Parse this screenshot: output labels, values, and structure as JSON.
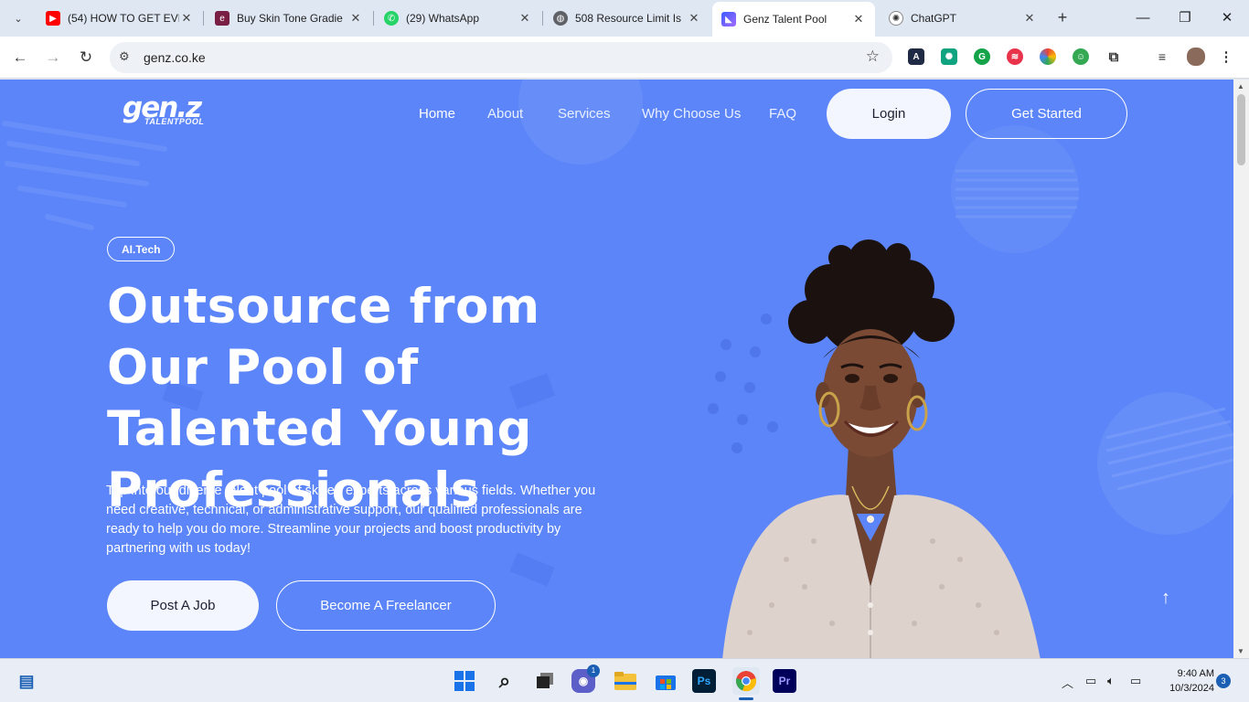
{
  "browser": {
    "tabs": [
      {
        "title": "(54) HOW TO GET EVE",
        "icon": "youtube-icon",
        "color": "#ff0000"
      },
      {
        "title": "Buy Skin Tone Gradie",
        "icon": "envato-icon",
        "color": "#7a1f44"
      },
      {
        "title": "(29) WhatsApp",
        "icon": "whatsapp-icon",
        "color": "#25d366"
      },
      {
        "title": "508 Resource Limit Is",
        "icon": "globe-icon",
        "color": "#5f6368"
      },
      {
        "title": "Genz Talent Pool",
        "icon": "genz-icon",
        "color": "#3d5afe"
      },
      {
        "title": "ChatGPT",
        "icon": "chatgpt-icon",
        "color": "#333333"
      }
    ],
    "active_tab": 4,
    "url": "genz.co.ke"
  },
  "site": {
    "logo_main": "gen.z",
    "logo_sub": "TALENTPOOL",
    "nav": [
      "Home",
      "About",
      "Services",
      "Why Choose Us",
      "FAQ"
    ],
    "login_label": "Login",
    "get_started_label": "Get Started"
  },
  "hero": {
    "tag": "AI.Tech",
    "headline": "Outsource from Our Pool of Talented Young Professionals",
    "description": "Tap into our diverse talent pool of skilled experts across various fields. Whether you need creative, technical, or administrative support, our qualified professionals are ready to help you do more. Streamline your projects and boost productivity by partnering with us today!",
    "primary_button": "Post A Job",
    "secondary_button": "Become A Freelancer"
  },
  "taskbar": {
    "time": "9:40 AM",
    "date": "10/3/2024",
    "notification_count": "3",
    "teams_badge": "1"
  },
  "colors": {
    "hero_bg": "#5b85f8",
    "button_light": "#f4f6ff",
    "text_white": "#ffffff"
  }
}
